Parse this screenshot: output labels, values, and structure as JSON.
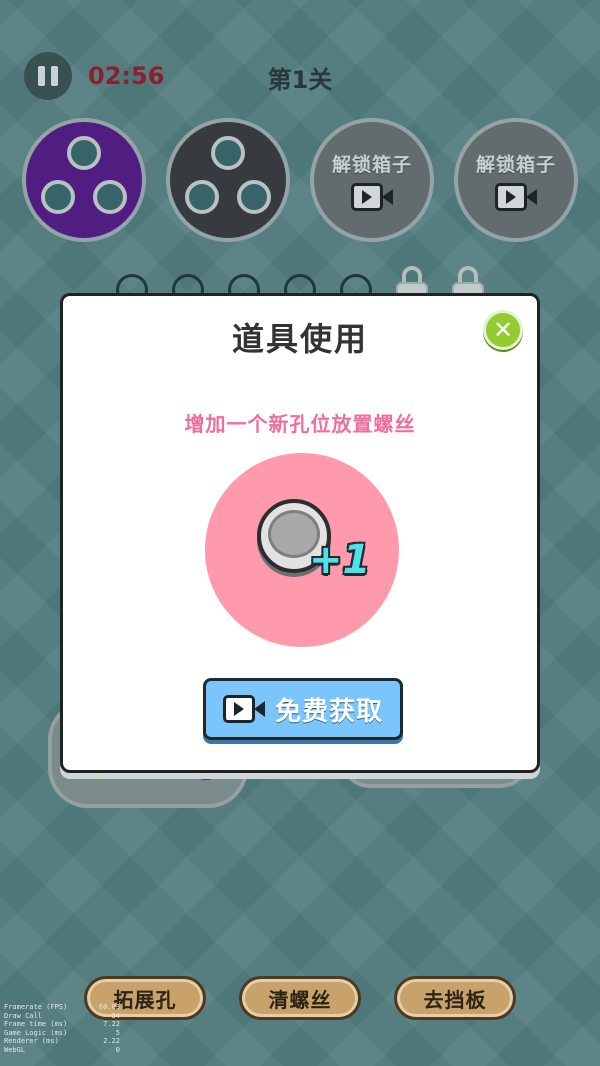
{
  "hud": {
    "timer": "02:56",
    "level": "第1关"
  },
  "boxes": [
    {
      "color": "#5a1a8e"
    },
    {
      "color": "#3c3d40"
    },
    {
      "label": "解锁箱子",
      "icon": "video-icon"
    },
    {
      "label": "解锁箱子",
      "icon": "video-icon"
    }
  ],
  "modal": {
    "title": "道具使用",
    "description": "增加一个新孔位放置螺丝",
    "badge": "+1",
    "action_label": "免费获取",
    "close_icon": "close-icon"
  },
  "toolbar": {
    "expand_label": "拓展孔",
    "clear_label": "清螺丝",
    "remove_label": "去挡板"
  },
  "stats": [
    {
      "label": "Framerate (FPS)",
      "value": "60.03"
    },
    {
      "label": "Draw Call",
      "value": "34"
    },
    {
      "label": "Frame time (ms)",
      "value": "7.22"
    },
    {
      "label": "Game Logic (ms)",
      "value": "5"
    },
    {
      "label": "Renderer (ms)",
      "value": "2.22"
    },
    {
      "label": "WebGL",
      "value": "0"
    }
  ]
}
